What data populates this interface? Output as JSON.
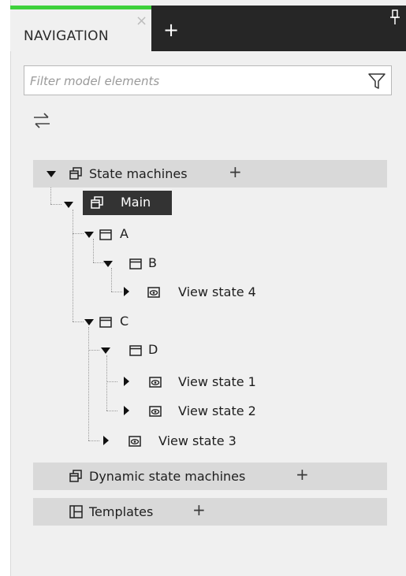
{
  "tab": {
    "label": "NAVIGATION",
    "close_glyph": "×",
    "add_glyph": "+"
  },
  "colors": {
    "accent": "#3dd13b",
    "tabstrip": "#262626",
    "selected": "#333333",
    "section_bg": "#d9d9d9"
  },
  "filter": {
    "placeholder": "Filter model elements",
    "value": ""
  },
  "icons": [
    "pin-icon",
    "funnel-icon",
    "swap-arrows-icon",
    "state-machine-icon",
    "state-icon",
    "view-state-icon",
    "template-icon"
  ],
  "sections": {
    "state_machines": {
      "label": "State machines",
      "plus": "+"
    },
    "dynamic": {
      "label": "Dynamic state machines",
      "plus": "+"
    },
    "templates": {
      "label": "Templates",
      "plus": "+"
    }
  },
  "tree": {
    "main": "Main",
    "a": "A",
    "b": "B",
    "view_state_4": "View state 4",
    "c": "C",
    "d": "D",
    "view_state_1": "View state 1",
    "view_state_2": "View state 2",
    "view_state_3": "View state 3"
  }
}
